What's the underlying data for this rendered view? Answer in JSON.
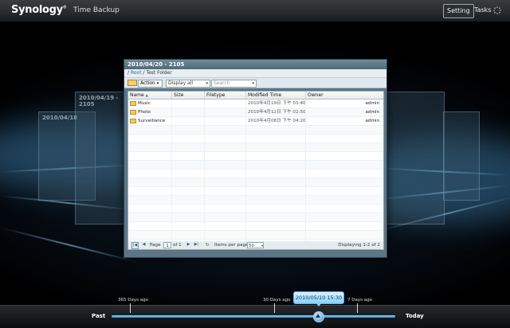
{
  "header": {
    "brand": "Synology",
    "brand_mark": "®",
    "app_name": "Time Backup",
    "setting_label": "Setting",
    "tasks_label": "Tasks"
  },
  "ghost_windows": [
    {
      "title": "2010/04/19 - 2105"
    },
    {
      "title": "2010/04/18"
    }
  ],
  "window": {
    "title": "2010/04/20 - 2105",
    "breadcrumb": {
      "sep": "/",
      "root": "Root",
      "current": "Test Folder"
    },
    "toolbar": {
      "action_label": "Action",
      "display_value": "Display all",
      "search_placeholder": "Search"
    },
    "columns": [
      "Name",
      "Size",
      "Filetype",
      "Modified Time",
      "Owner"
    ],
    "sort_indicator": "▲",
    "rows": [
      {
        "name": "Music",
        "size": "",
        "type": "",
        "modified": "2010年4月19日 下午 03:40",
        "owner": "admin"
      },
      {
        "name": "Photo",
        "size": "",
        "type": "",
        "modified": "2010年4月12日 下午 02:50",
        "owner": "admin"
      },
      {
        "name": "Surveillance",
        "size": "",
        "type": "",
        "modified": "2010年4月08日 下午 04:20",
        "owner": "admin"
      }
    ],
    "empty_rows": 15,
    "pager": {
      "page_label": "Page",
      "page_value": "1",
      "of_label": "of 1",
      "items_per_page_label": "Items per page",
      "items_per_page_value": "50",
      "displaying": "Displaying 1-2 of 2"
    }
  },
  "timeline": {
    "past_label": "Past",
    "today_label": "Today",
    "ticks": [
      "365 Days ago",
      "30 Days ago",
      "7 Days ago"
    ],
    "selected": "2010/05/10 15:30"
  },
  "colors": {
    "accent": "#3b8fd0",
    "bubble": "#8ccfff",
    "window_frame": "#5c7686"
  }
}
